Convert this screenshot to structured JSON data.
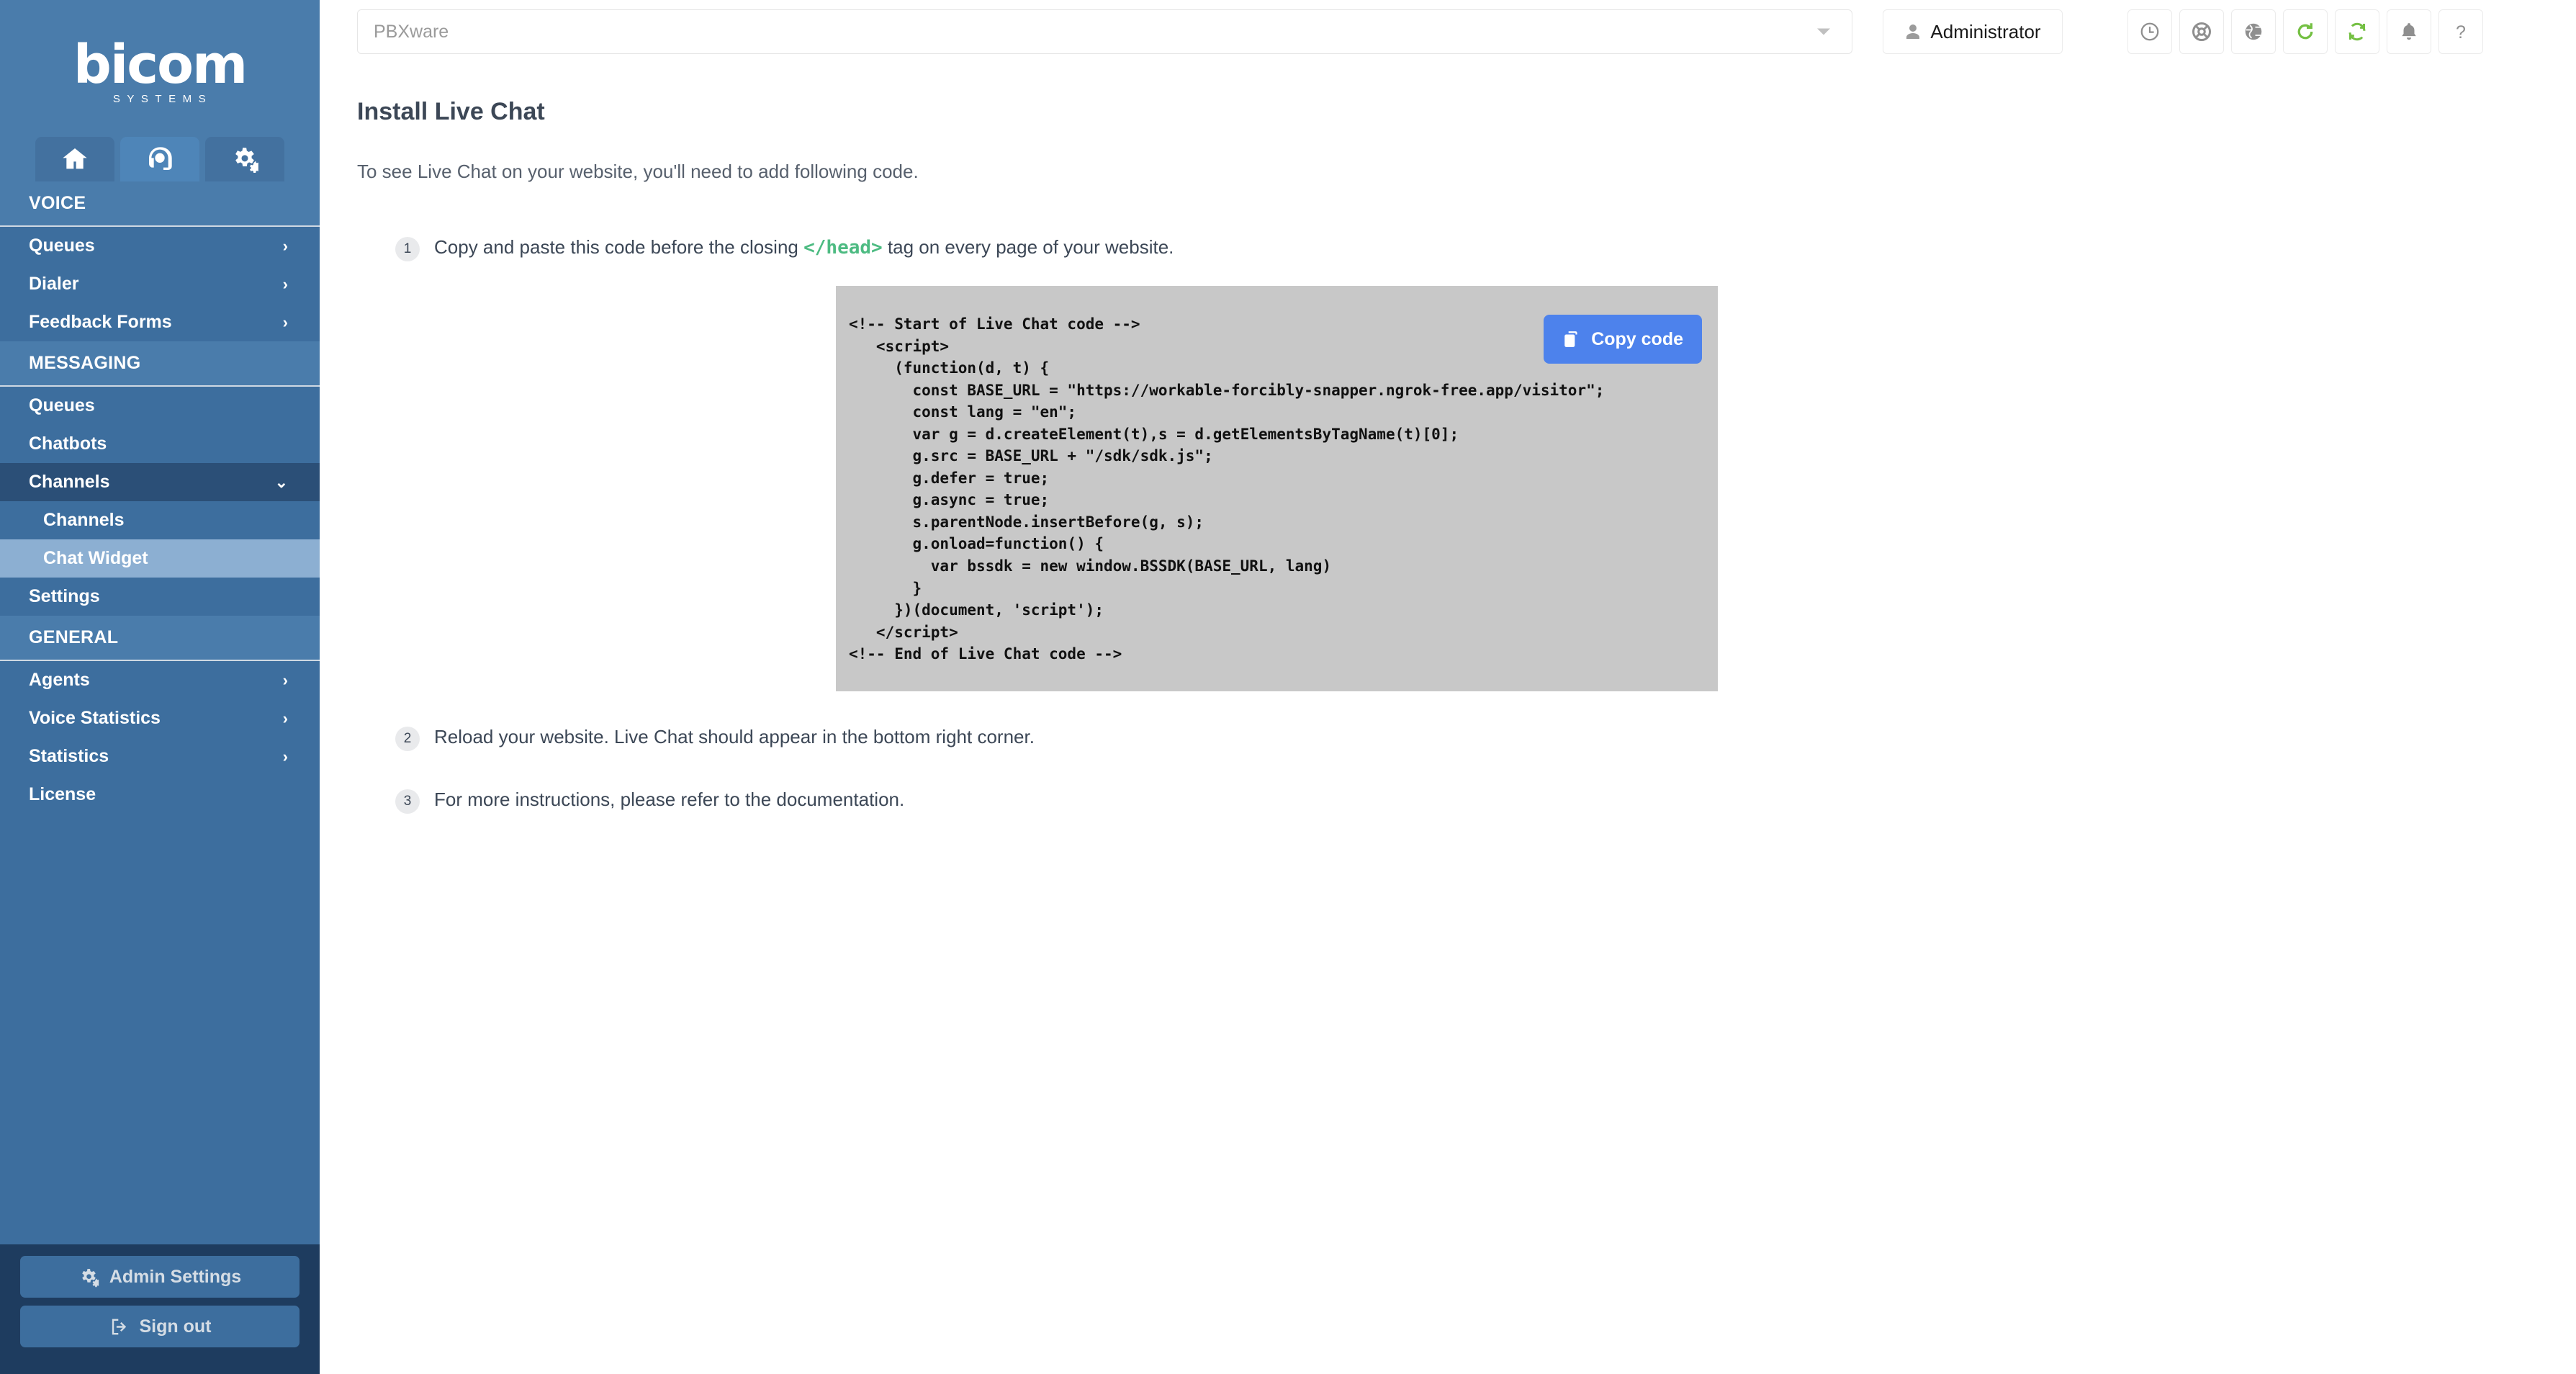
{
  "brand": {
    "logo_main": "bicom",
    "logo_sub": "SYSTEMS",
    "accent_blue": "#3d6e9e",
    "accent_dark": "#1e3c5f",
    "accent_green": "#74c043",
    "copy_button_blue": "#4d82ec"
  },
  "sidebar": {
    "tabs": [
      {
        "name": "home-tab",
        "icon": "home-icon",
        "active": false
      },
      {
        "name": "contact-center-tab",
        "icon": "headset-icon",
        "active": true
      },
      {
        "name": "settings-tab",
        "icon": "gears-icon",
        "active": false
      }
    ],
    "sections": [
      {
        "heading": "VOICE",
        "items": [
          {
            "label": "Queues",
            "chevron": "right",
            "state": "normal"
          },
          {
            "label": "Dialer",
            "chevron": "right",
            "state": "normal"
          },
          {
            "label": "Feedback Forms",
            "chevron": "right",
            "state": "normal"
          }
        ]
      },
      {
        "heading": "MESSAGING",
        "items": [
          {
            "label": "Queues",
            "chevron": "",
            "state": "normal"
          },
          {
            "label": "Chatbots",
            "chevron": "",
            "state": "normal"
          },
          {
            "label": "Channels",
            "chevron": "down",
            "state": "open"
          },
          {
            "label": "Channels",
            "chevron": "",
            "state": "sub"
          },
          {
            "label": "Chat Widget",
            "chevron": "",
            "state": "sub-selected"
          },
          {
            "label": "Settings",
            "chevron": "",
            "state": "normal"
          }
        ]
      },
      {
        "heading": "GENERAL",
        "items": [
          {
            "label": "Agents",
            "chevron": "right",
            "state": "normal"
          },
          {
            "label": "Voice Statistics",
            "chevron": "right",
            "state": "normal"
          },
          {
            "label": "Statistics",
            "chevron": "right",
            "state": "normal"
          },
          {
            "label": "License",
            "chevron": "",
            "state": "normal"
          }
        ]
      }
    ],
    "footer_buttons": [
      {
        "label": "Admin Settings",
        "icon": "gears-icon"
      },
      {
        "label": "Sign out",
        "icon": "sign-out-icon"
      }
    ]
  },
  "topbar": {
    "server_select_value": "PBXware",
    "server_select_placeholder": "PBXware",
    "admin_label": "Administrator",
    "admin_icon": "user-icon",
    "icons": [
      {
        "name": "clock-icon",
        "color": "gray"
      },
      {
        "name": "life-ring-icon",
        "color": "gray"
      },
      {
        "name": "globe-icon",
        "color": "gray"
      },
      {
        "name": "refresh-icon",
        "color": "green"
      },
      {
        "name": "sync-icon",
        "color": "green"
      },
      {
        "name": "bell-icon",
        "color": "gray"
      },
      {
        "name": "help-icon",
        "color": "gray"
      }
    ]
  },
  "page": {
    "title": "Install Live Chat",
    "lead": "To see Live Chat on your website, you'll need to add following code.",
    "steps": [
      {
        "number": "1",
        "text_before": "Copy and paste this code before the closing ",
        "highlight": "</head>",
        "text_after": " tag on every page of your website."
      },
      {
        "number": "2",
        "text_before": "Reload your website. Live Chat should appear in the bottom right corner.",
        "highlight": "",
        "text_after": ""
      },
      {
        "number": "3",
        "text_before": "For more instructions, please refer to the documentation.",
        "highlight": "",
        "text_after": ""
      }
    ],
    "code_block": {
      "copy_button_label": "Copy code",
      "copy_button_icon": "copy-icon",
      "code": "<!-- Start of Live Chat code -->\n   <script>\n     (function(d, t) {\n       const BASE_URL = \"https://workable-forcibly-snapper.ngrok-free.app/visitor\";\n       const lang = \"en\";\n       var g = d.createElement(t),s = d.getElementsByTagName(t)[0];\n       g.src = BASE_URL + \"/sdk/sdk.js\";\n       g.defer = true;\n       g.async = true;\n       s.parentNode.insertBefore(g, s);\n       g.onload=function() {\n         var bssdk = new window.BSSDK(BASE_URL, lang)\n       }\n     })(document, 'script');\n   </script>\n<!-- End of Live Chat code -->"
    }
  }
}
